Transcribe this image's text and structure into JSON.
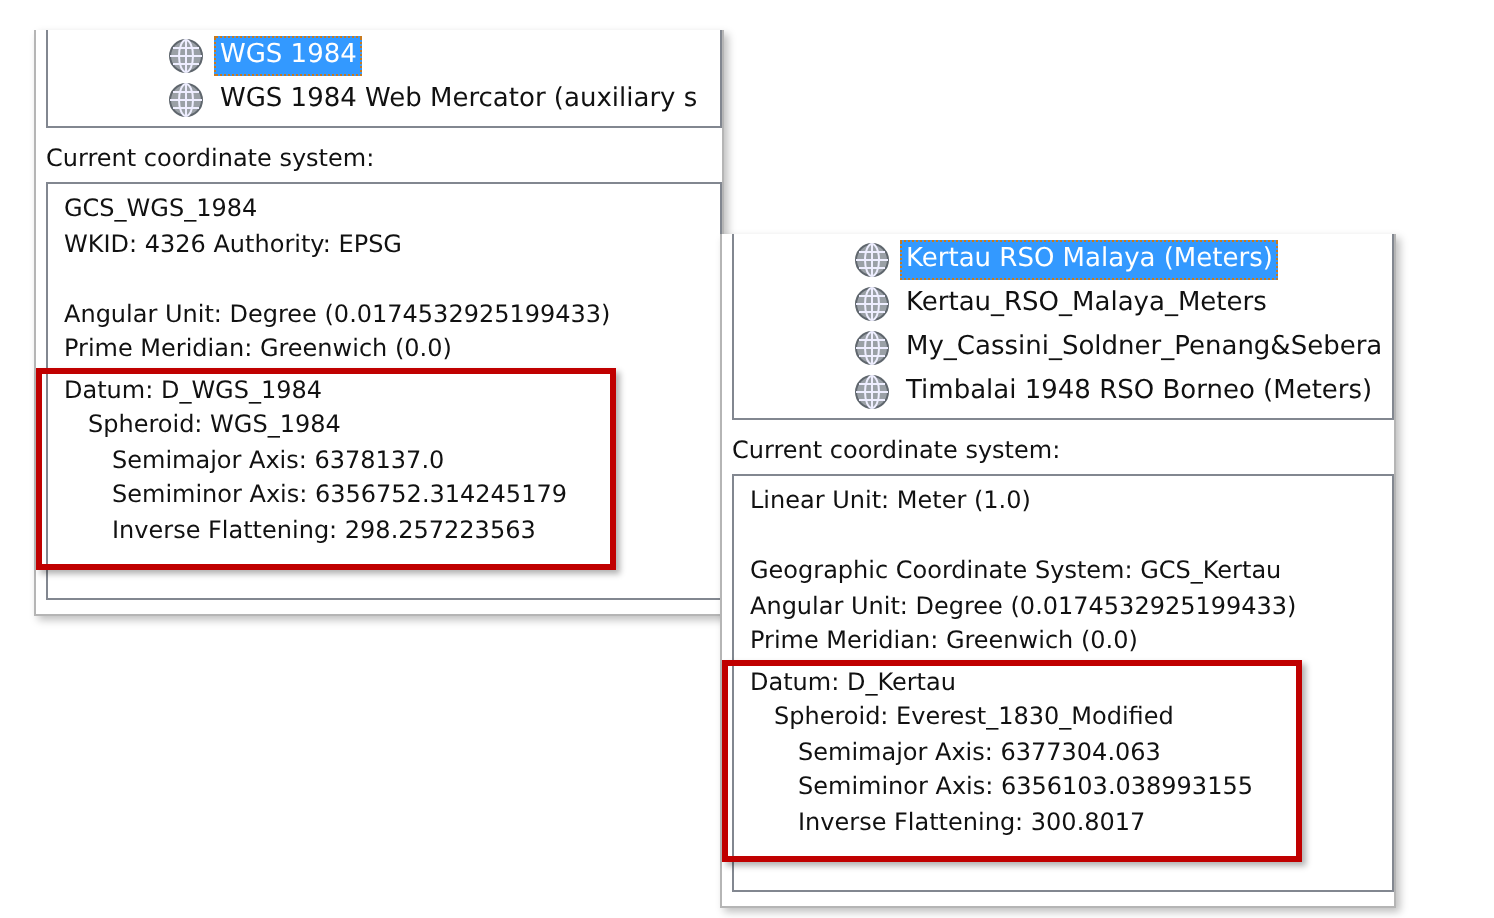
{
  "panels": [
    {
      "tree_items": [
        {
          "label": "WGS 1984",
          "selected": true
        },
        {
          "label": "WGS 1984 Web Mercator (auxiliary s",
          "selected": false
        }
      ],
      "section_label": "Current coordinate system:",
      "details": [
        [
          {
            "text": "GCS_WGS_1984",
            "highlighted": false
          },
          {
            "text": "WKID: 4326 Authority: EPSG",
            "highlighted": false
          }
        ],
        [
          {
            "text": "Angular Unit: Degree (0.0174532925199433)",
            "highlighted": false
          },
          {
            "text": "Prime Meridian: Greenwich (0.0)",
            "highlighted": false
          },
          {
            "text": "Datum: D_WGS_1984",
            "highlighted": true,
            "children": [
              {
                "text": "Spheroid: WGS_1984",
                "children": [
                  {
                    "text": "Semimajor Axis: 6378137.0"
                  },
                  {
                    "text": "Semiminor Axis: 6356752.314245179"
                  },
                  {
                    "text": "Inverse Flattening: 298.257223563"
                  }
                ]
              }
            ]
          }
        ]
      ]
    },
    {
      "tree_items": [
        {
          "label": "Kertau RSO Malaya (Meters)",
          "selected": true
        },
        {
          "label": "Kertau_RSO_Malaya_Meters",
          "selected": false
        },
        {
          "label": "My_Cassini_Soldner_Penang&Sebera",
          "selected": false
        },
        {
          "label": "Timbalai 1948 RSO Borneo (Meters)",
          "selected": false
        }
      ],
      "section_label": "Current coordinate system:",
      "details": [
        [
          {
            "text": "Linear Unit: Meter (1.0)",
            "highlighted": false
          }
        ],
        [
          {
            "text": "Geographic Coordinate System: GCS_Kertau",
            "highlighted": false
          },
          {
            "text": "Angular Unit: Degree (0.0174532925199433)",
            "highlighted": false
          },
          {
            "text": "Prime Meridian: Greenwich (0.0)",
            "highlighted": false
          },
          {
            "text": "Datum: D_Kertau",
            "highlighted": true,
            "children": [
              {
                "text": "Spheroid: Everest_1830_Modified",
                "children": [
                  {
                    "text": "Semimajor Axis: 6377304.063"
                  },
                  {
                    "text": "Semiminor Axis: 6356103.038993155"
                  },
                  {
                    "text": "Inverse Flattening: 300.8017"
                  }
                ]
              }
            ]
          }
        ]
      ]
    }
  ]
}
